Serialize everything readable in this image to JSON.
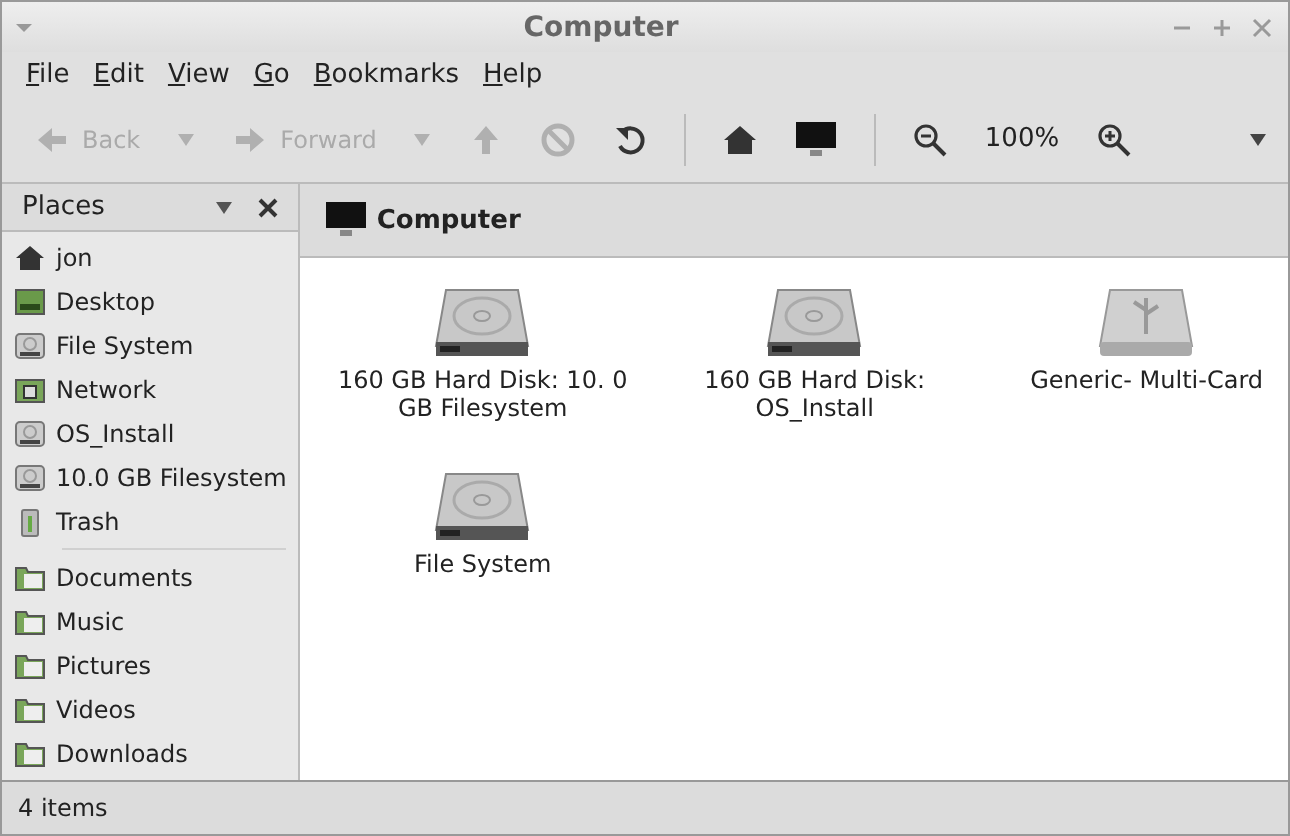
{
  "window": {
    "title": "Computer"
  },
  "menu": [
    "File",
    "Edit",
    "View",
    "Go",
    "Bookmarks",
    "Help"
  ],
  "toolbar": [
    {
      "kind": "back",
      "label": "Back",
      "disabled": true
    },
    {
      "kind": "dropdown",
      "disabled": true
    },
    {
      "kind": "forward",
      "label": "Forward",
      "disabled": true
    },
    {
      "kind": "dropdown",
      "disabled": true
    },
    {
      "kind": "up",
      "disabled": true
    },
    {
      "kind": "stop",
      "disabled": true
    },
    {
      "kind": "reload",
      "disabled": false
    },
    {
      "kind": "separator"
    },
    {
      "kind": "home",
      "disabled": false
    },
    {
      "kind": "computer",
      "disabled": false
    },
    {
      "kind": "separator"
    },
    {
      "kind": "zoom-out",
      "disabled": false
    },
    {
      "kind": "zoom-level",
      "label": "100%"
    },
    {
      "kind": "zoom-in",
      "disabled": false
    }
  ],
  "sidebar": {
    "title": "Places",
    "items": [
      {
        "kind": "home",
        "label": "jon"
      },
      {
        "kind": "desktop",
        "label": "Desktop"
      },
      {
        "kind": "drive",
        "label": "File System"
      },
      {
        "kind": "network",
        "label": "Network"
      },
      {
        "kind": "drive",
        "label": "OS_Install"
      },
      {
        "kind": "drive",
        "label": "10.0 GB Filesystem"
      },
      {
        "kind": "trash",
        "label": "Trash"
      },
      {
        "kind": "separator"
      },
      {
        "kind": "folder",
        "label": "Documents"
      },
      {
        "kind": "folder",
        "label": "Music"
      },
      {
        "kind": "folder",
        "label": "Pictures"
      },
      {
        "kind": "folder",
        "label": "Videos"
      },
      {
        "kind": "folder",
        "label": "Downloads"
      }
    ]
  },
  "location": {
    "title": "Computer"
  },
  "files": [
    {
      "kind": "hdd",
      "label": "160 GB Hard Disk: 10. 0 GB Filesystem"
    },
    {
      "kind": "hdd",
      "label": "160 GB Hard Disk: OS_Install"
    },
    {
      "kind": "usb",
      "label": "Generic- Multi-Card"
    },
    {
      "kind": "hdd",
      "label": "File System"
    }
  ],
  "status_bar": {
    "text": "4 items"
  }
}
